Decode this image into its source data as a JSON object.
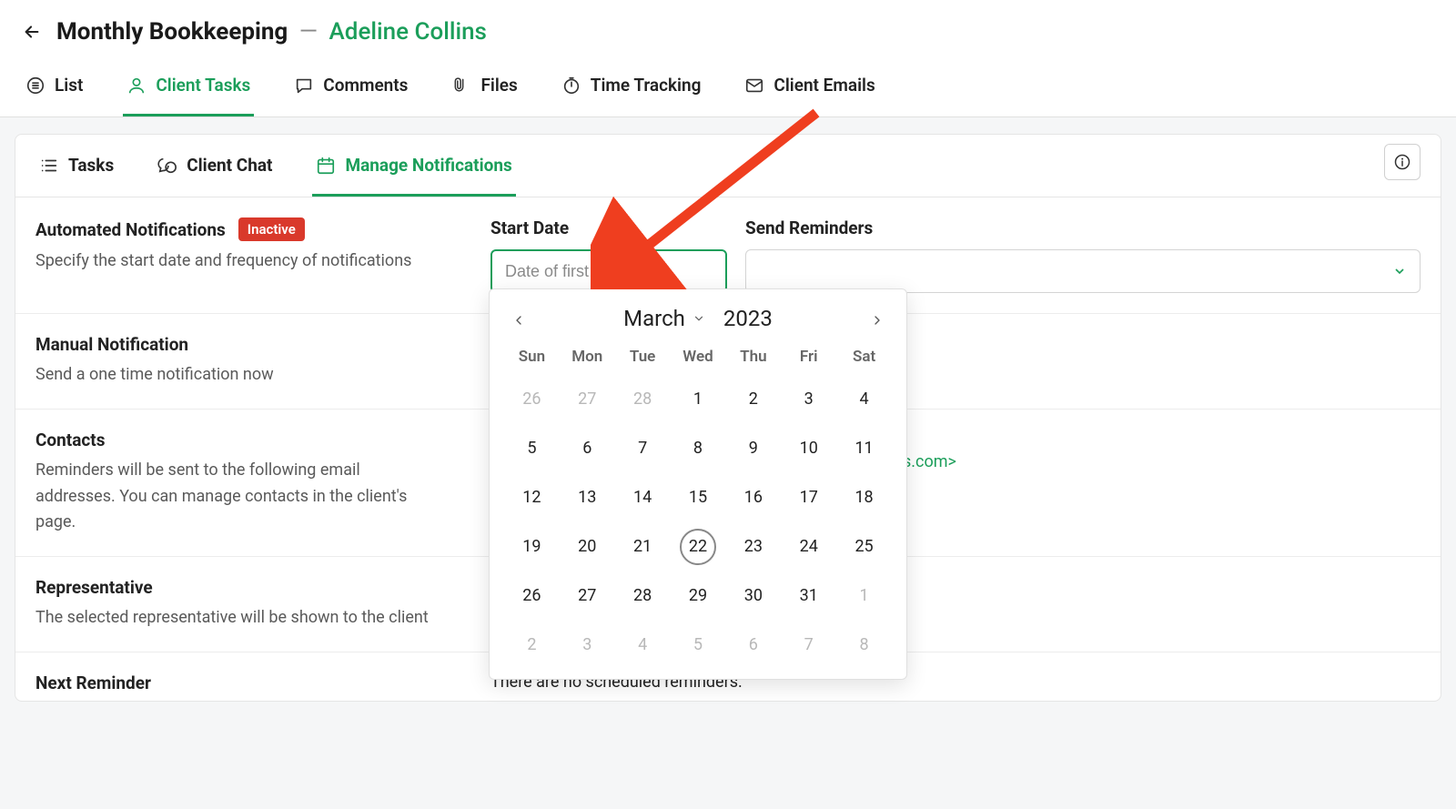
{
  "header": {
    "title": "Monthly Bookkeeping",
    "client": "Adeline Collins"
  },
  "topTabs": {
    "list": "List",
    "clientTasks": "Client Tasks",
    "comments": "Comments",
    "files": "Files",
    "timeTracking": "Time Tracking",
    "clientEmails": "Client Emails"
  },
  "subTabs": {
    "tasks": "Tasks",
    "clientChat": "Client Chat",
    "manageNotifications": "Manage Notifications"
  },
  "sections": {
    "automated": {
      "title": "Automated Notifications",
      "badge": "Inactive",
      "desc": "Specify the start date and frequency of notifications"
    },
    "startDate": {
      "label": "Start Date",
      "placeholder": "Date of first reminder"
    },
    "sendReminders": {
      "label": "Send Reminders"
    },
    "manual": {
      "title": "Manual Notification",
      "desc": "Send a one time notification now"
    },
    "contacts": {
      "title": "Contacts",
      "desc": "Reminders will be sent to the following email addresses. You can manage contacts in the client's page.",
      "emailFragment": "s.com>"
    },
    "representative": {
      "title": "Representative",
      "desc": "The selected representative will be shown to the client"
    },
    "nextReminder": {
      "title": "Next Reminder",
      "msg": "There are no scheduled reminders."
    }
  },
  "calendar": {
    "month": "March",
    "year": "2023",
    "dows": [
      "Sun",
      "Mon",
      "Tue",
      "Wed",
      "Thu",
      "Fri",
      "Sat"
    ],
    "cells": [
      {
        "n": "26",
        "out": true
      },
      {
        "n": "27",
        "out": true
      },
      {
        "n": "28",
        "out": true
      },
      {
        "n": "1"
      },
      {
        "n": "2"
      },
      {
        "n": "3"
      },
      {
        "n": "4"
      },
      {
        "n": "5"
      },
      {
        "n": "6"
      },
      {
        "n": "7"
      },
      {
        "n": "8"
      },
      {
        "n": "9"
      },
      {
        "n": "10"
      },
      {
        "n": "11"
      },
      {
        "n": "12"
      },
      {
        "n": "13"
      },
      {
        "n": "14"
      },
      {
        "n": "15"
      },
      {
        "n": "16"
      },
      {
        "n": "17"
      },
      {
        "n": "18"
      },
      {
        "n": "19"
      },
      {
        "n": "20"
      },
      {
        "n": "21"
      },
      {
        "n": "22",
        "today": true
      },
      {
        "n": "23"
      },
      {
        "n": "24"
      },
      {
        "n": "25"
      },
      {
        "n": "26"
      },
      {
        "n": "27"
      },
      {
        "n": "28"
      },
      {
        "n": "29"
      },
      {
        "n": "30"
      },
      {
        "n": "31"
      },
      {
        "n": "1",
        "out": true
      },
      {
        "n": "2",
        "out": true
      },
      {
        "n": "3",
        "out": true
      },
      {
        "n": "4",
        "out": true
      },
      {
        "n": "5",
        "out": true
      },
      {
        "n": "6",
        "out": true
      },
      {
        "n": "7",
        "out": true
      },
      {
        "n": "8",
        "out": true
      }
    ]
  }
}
